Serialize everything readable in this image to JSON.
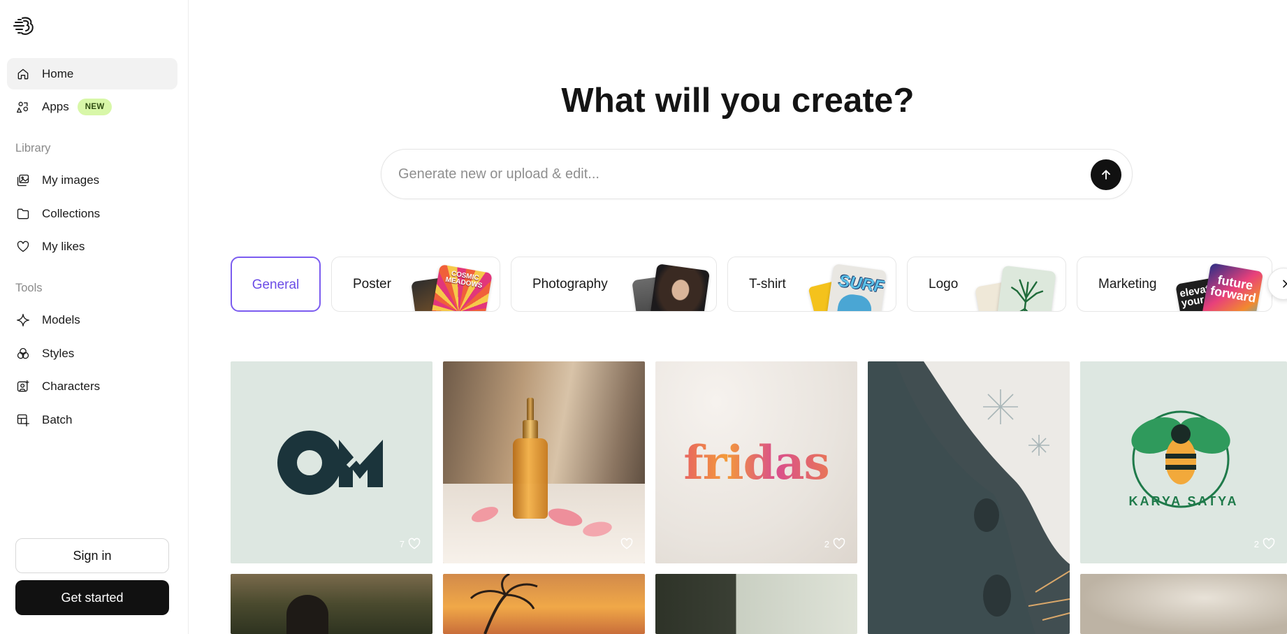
{
  "sidebar": {
    "nav": [
      {
        "label": "Home",
        "icon": "home-icon"
      },
      {
        "label": "Apps",
        "icon": "apps-icon",
        "badge": "NEW"
      }
    ],
    "library_label": "Library",
    "library": [
      {
        "label": "My images",
        "icon": "images-icon"
      },
      {
        "label": "Collections",
        "icon": "folder-icon"
      },
      {
        "label": "My likes",
        "icon": "heart-icon"
      }
    ],
    "tools_label": "Tools",
    "tools": [
      {
        "label": "Models",
        "icon": "sparkle-icon"
      },
      {
        "label": "Styles",
        "icon": "styles-icon"
      },
      {
        "label": "Characters",
        "icon": "character-icon"
      },
      {
        "label": "Batch",
        "icon": "batch-icon"
      }
    ],
    "sign_in": "Sign in",
    "get_started": "Get started"
  },
  "main": {
    "headline": "What will you create?",
    "prompt_placeholder": "Generate new or upload & edit...",
    "categories": [
      "General",
      "Poster",
      "Photography",
      "T-shirt",
      "Logo",
      "Marketing"
    ],
    "gallery": [
      {
        "likes": "7"
      },
      {
        "likes": ""
      },
      {
        "likes": "2"
      },
      {
        "likes": ""
      },
      {
        "likes": "2"
      }
    ],
    "thumb_texts": {
      "poster": "COSMIC MEADOWS",
      "tshirt": "SURF",
      "marketing": "future forward",
      "marketing_back": "elevate your"
    },
    "gallery_texts": {
      "logo_card": "ON",
      "fridas_card": "fridas",
      "bee_card": "KARYA SATYA"
    }
  },
  "colors": {
    "accent": "#7b5cf0",
    "badge_bg": "#d8f7a8",
    "primary_button": "#111111"
  }
}
